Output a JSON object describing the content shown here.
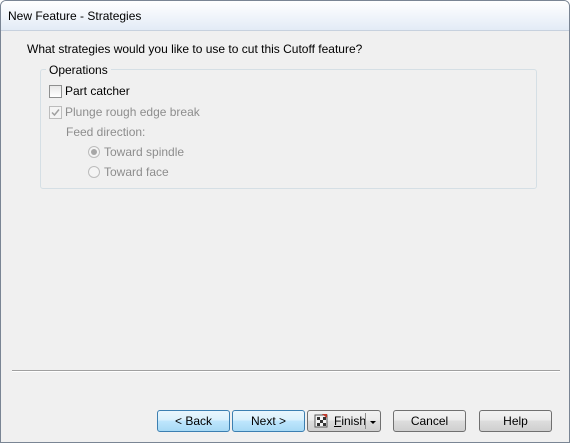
{
  "window": {
    "title": "New Feature - Strategies"
  },
  "prompt": "What strategies would you like to use to cut this Cutoff feature?",
  "operations": {
    "legend": "Operations",
    "part_catcher": {
      "label": "Part catcher",
      "checked": false,
      "enabled": true
    },
    "plunge_rough": {
      "label": "Plunge rough edge break",
      "checked": true,
      "enabled": false
    },
    "feed_direction_label": "Feed direction:",
    "feed_options": [
      {
        "label": "Toward spindle",
        "selected": true,
        "enabled": false
      },
      {
        "label": "Toward face",
        "selected": false,
        "enabled": false
      }
    ]
  },
  "buttons": {
    "back": "< Back",
    "next": "Next >",
    "finish_prefix": "",
    "finish_underlined": "F",
    "finish_rest": "inish",
    "cancel": "Cancel",
    "help": "Help"
  },
  "icons": {
    "finish": "finish-flag-icon",
    "checkmark": "checkmark-icon",
    "dropdown": "dropdown-arrow-icon"
  }
}
